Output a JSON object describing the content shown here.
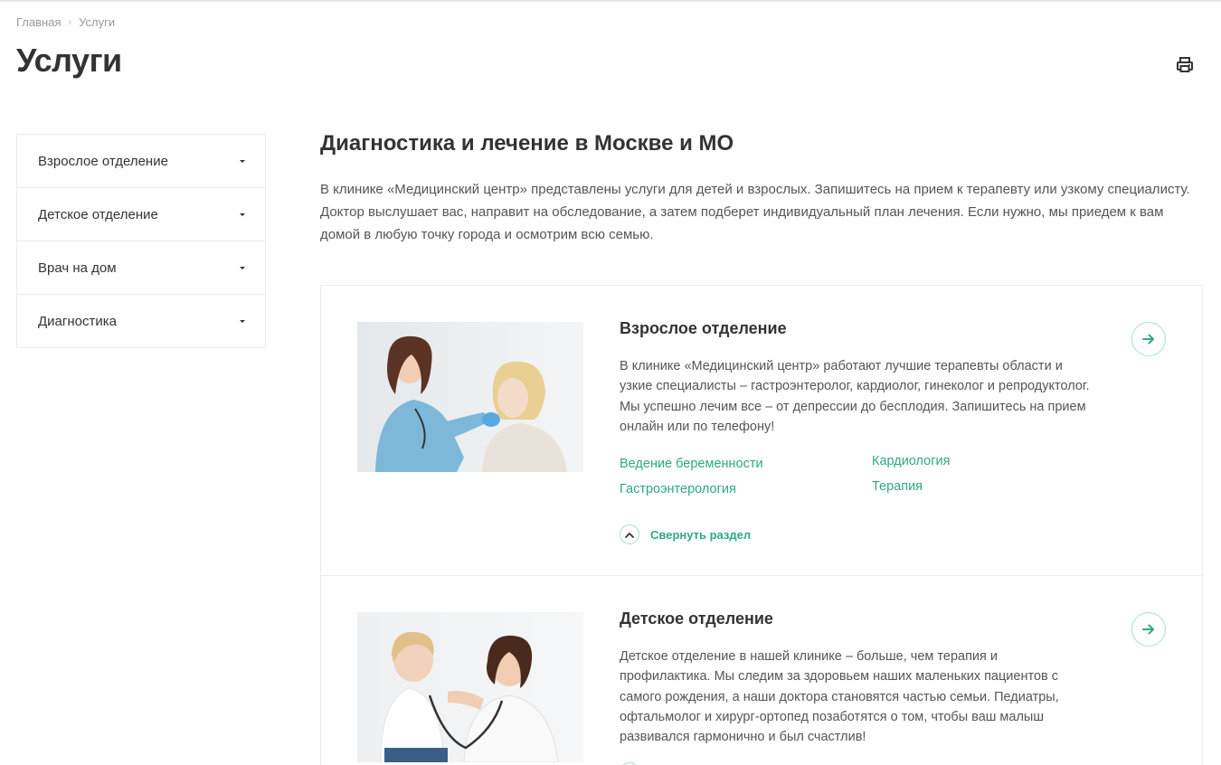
{
  "breadcrumb": {
    "home": "Главная",
    "sep": "›",
    "current": "Услуги"
  },
  "page": {
    "title": "Услуги"
  },
  "sidebar": {
    "items": [
      {
        "label": "Взрослое отделение"
      },
      {
        "label": "Детское отделение"
      },
      {
        "label": "Врач на дом"
      },
      {
        "label": "Диагностика"
      }
    ]
  },
  "main": {
    "title": "Диагностика и лечение в Москве и МО",
    "intro": "В клинике «Медицинский центр» представлены услуги для детей и взрослых. Запишитесь на прием к терапевту или узкому специалисту. Доктор выслушает вас, направит на обследование, а затем подберет индивидуальный план лечения. Если нужно, мы приедем к вам домой в любую точку города и осмотрим всю семью."
  },
  "cards": [
    {
      "title": "Взрослое отделение",
      "text": "В клинике «Медицинский центр» работают лучшие терапевты области и узкие специалисты – гастроэнтеролог, кардиолог, гинеколог и репродуктолог. Мы успешно лечим все – от депрессии до бесплодия. Запишитесь на прием онлайн или по телефону!",
      "links": [
        "Ведение беременности",
        "Гастроэнтерология",
        "Кардиология",
        "Терапия"
      ],
      "collapse_label": "Свернуть раздел"
    },
    {
      "title": "Детское отделение",
      "text": "Детское отделение в нашей клинике – больше, чем терапия и профилактика. Мы следим за здоровьем наших маленьких пациентов с самого рождения, а наши доктора становятся частью семьи. Педиатры, офтальмолог и хирург-ортопед позаботятся о том, чтобы ваш малыш развивался гармонично и был счастлив!"
    }
  ],
  "icons": {
    "print": "printer-icon",
    "arrow": "arrow-right-icon",
    "collapse": "chevron-up-icon",
    "caret": "caret-down-icon"
  },
  "colors": {
    "accent": "#2ea884",
    "accent_border": "#a8e0cf",
    "border": "#ececec",
    "text": "#333333"
  }
}
